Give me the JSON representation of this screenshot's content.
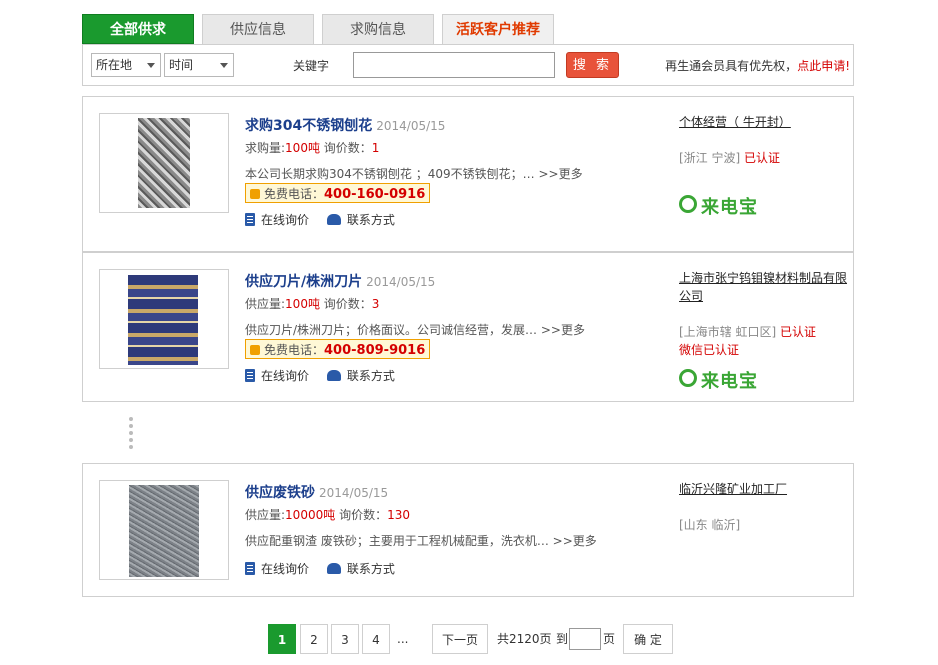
{
  "tabs": [
    {
      "label": "全部供求"
    },
    {
      "label": "供应信息"
    },
    {
      "label": "求购信息"
    },
    {
      "label": "活跃客户推荐"
    }
  ],
  "filters": {
    "location_select": "所在地",
    "time_select": "时间",
    "keyword_label": "关键字",
    "keyword_value": "",
    "search_button": "搜 索",
    "promo_text": "再生通会员具有优先权，",
    "promo_link": "点此申请!"
  },
  "listings": [
    {
      "title": "求购304不锈钢刨花",
      "date": "2014/05/15",
      "qty_label": "求购量:",
      "qty_value": "100吨",
      "inquiry_label": "询价数：",
      "inquiry_value": "1",
      "desc": "本公司长期求购304不锈钢刨花 ；409不锈铁刨花；…",
      "more": ">>更多",
      "phone_label": "免费电话：",
      "phone": "400-160-0916",
      "action_inquiry": "在线询价",
      "action_contact": "联系方式",
      "company": "个体经营（ 牛开封）",
      "location": "[浙江 宁波]",
      "certified": "已认证",
      "wechat": "",
      "badge": "来电宝"
    },
    {
      "title": "供应刀片/株洲刀片",
      "date": "2014/05/15",
      "qty_label": "供应量:",
      "qty_value": "100吨",
      "inquiry_label": "询价数：",
      "inquiry_value": "3",
      "desc": "供应刀片/株洲刀片；价格面议。公司诚信经营，发展…",
      "more": ">>更多",
      "phone_label": "免费电话：",
      "phone": "400-809-9016",
      "action_inquiry": "在线询价",
      "action_contact": "联系方式",
      "company": "上海市张宁钨钼镍材料制品有限公司",
      "location": "[上海市辖 虹口区]",
      "certified": "已认证",
      "wechat": "微信已认证",
      "badge": "来电宝"
    },
    {
      "title": "供应废铁砂",
      "date": "2014/05/15",
      "qty_label": "供应量:",
      "qty_value": "10000吨",
      "inquiry_label": "询价数：",
      "inquiry_value": "130",
      "desc": "供应配重钢渣 废铁砂；主要用于工程机械配重，洗衣机…",
      "more": ">>更多",
      "phone_label": "",
      "phone": "",
      "action_inquiry": "在线询价",
      "action_contact": "联系方式",
      "company": "临沂兴隆矿业加工厂",
      "location": "[山东 临沂]",
      "certified": "",
      "wechat": "",
      "badge": ""
    }
  ],
  "pagination": {
    "pages": [
      "1",
      "2",
      "3",
      "4"
    ],
    "current": "1",
    "ellipsis": "...",
    "next": "下一页",
    "total": "共2120页",
    "goto_label": "到",
    "page_suffix": "页",
    "confirm": "确 定"
  },
  "colors": {
    "accent_green": "#1a9a2e",
    "link_blue": "#1c3f8c",
    "highlight_red": "#d40000",
    "badge_green": "#3aa635"
  }
}
